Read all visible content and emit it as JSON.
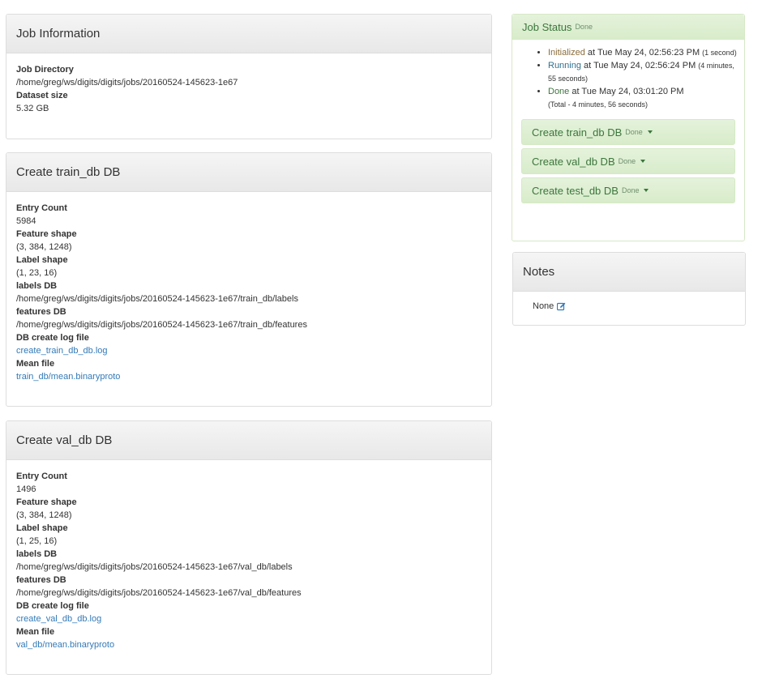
{
  "job_info": {
    "title": "Job Information",
    "items": [
      {
        "label": "Job Directory",
        "value": "/home/greg/ws/digits/digits/jobs/20160524-145623-1e67"
      },
      {
        "label": "Dataset size",
        "value": "5.32 GB"
      }
    ]
  },
  "train_db": {
    "title": "Create train_db DB",
    "entry_count_label": "Entry Count",
    "entry_count": "5984",
    "feature_shape_label": "Feature shape",
    "feature_shape": "(3, 384, 1248)",
    "label_shape_label": "Label shape",
    "label_shape": "(1, 23, 16)",
    "labels_db_label": "labels DB",
    "labels_db": "/home/greg/ws/digits/digits/jobs/20160524-145623-1e67/train_db/labels",
    "features_db_label": "features DB",
    "features_db": "/home/greg/ws/digits/digits/jobs/20160524-145623-1e67/train_db/features",
    "log_label": "DB create log file",
    "log_link": "create_train_db_db.log",
    "mean_label": "Mean file",
    "mean_link": "train_db/mean.binaryproto"
  },
  "val_db": {
    "title": "Create val_db DB",
    "entry_count_label": "Entry Count",
    "entry_count": "1496",
    "feature_shape_label": "Feature shape",
    "feature_shape": "(3, 384, 1248)",
    "label_shape_label": "Label shape",
    "label_shape": "(1, 25, 16)",
    "labels_db_label": "labels DB",
    "labels_db": "/home/greg/ws/digits/digits/jobs/20160524-145623-1e67/val_db/labels",
    "features_db_label": "features DB",
    "features_db": "/home/greg/ws/digits/digits/jobs/20160524-145623-1e67/val_db/features",
    "log_label": "DB create log file",
    "log_link": "create_val_db_db.log",
    "mean_label": "Mean file",
    "mean_link": "val_db/mean.binaryproto"
  },
  "job_status": {
    "title": "Job Status",
    "state": "Done",
    "events": [
      {
        "status": "Initialized",
        "text": " at Tue May 24, 02:56:23 PM ",
        "duration": "(1 second)"
      },
      {
        "status": "Running",
        "text": " at Tue May 24, 02:56:24 PM ",
        "duration": "(4 minutes, 55 seconds)"
      },
      {
        "status": "Done",
        "text": " at Tue May 24, 03:01:20 PM",
        "duration": "(Total - 4 minutes, 56 seconds)"
      }
    ],
    "tasks": [
      {
        "label": "Create train_db DB",
        "state": "Done"
      },
      {
        "label": "Create val_db DB",
        "state": "Done"
      },
      {
        "label": "Create test_db DB",
        "state": "Done"
      }
    ],
    "colors": {
      "success": "#3c763d",
      "info": "#31708f",
      "warning": "#8a6d3b"
    }
  },
  "notes": {
    "title": "Notes",
    "value": "None",
    "icon": "edit-icon"
  }
}
